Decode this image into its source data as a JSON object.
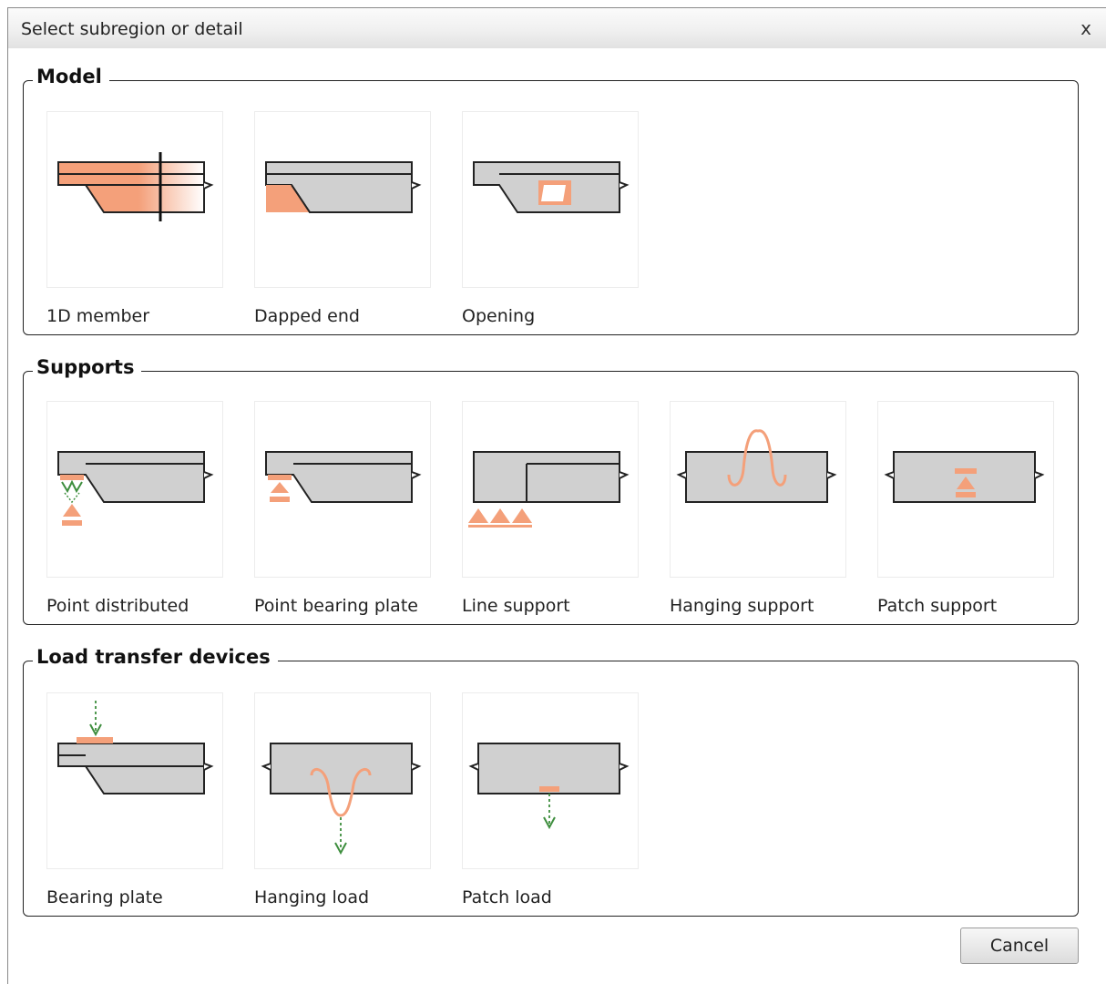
{
  "window": {
    "title": "Select subregion or detail",
    "close_glyph": "x"
  },
  "colors": {
    "accent": "#F4A07A",
    "member": "#D0D0D0",
    "outline": "#222222",
    "load": "#3E8E3E"
  },
  "groups": {
    "model": {
      "label": "Model",
      "items": [
        {
          "label": "1D member",
          "icon": "1d-member-icon"
        },
        {
          "label": "Dapped end",
          "icon": "dapped-end-icon"
        },
        {
          "label": "Opening",
          "icon": "opening-icon"
        }
      ]
    },
    "supports": {
      "label": "Supports",
      "items": [
        {
          "label": "Point distributed",
          "icon": "point-distributed-icon"
        },
        {
          "label": "Point bearing plate",
          "icon": "point-bearing-plate-icon"
        },
        {
          "label": "Line support",
          "icon": "line-support-icon"
        },
        {
          "label": "Hanging support",
          "icon": "hanging-support-icon"
        },
        {
          "label": "Patch support",
          "icon": "patch-support-icon"
        }
      ]
    },
    "load_transfer": {
      "label": "Load transfer devices",
      "items": [
        {
          "label": "Bearing plate",
          "icon": "bearing-plate-icon"
        },
        {
          "label": "Hanging load",
          "icon": "hanging-load-icon"
        },
        {
          "label": "Patch load",
          "icon": "patch-load-icon"
        }
      ]
    }
  },
  "footer": {
    "cancel_label": "Cancel"
  }
}
